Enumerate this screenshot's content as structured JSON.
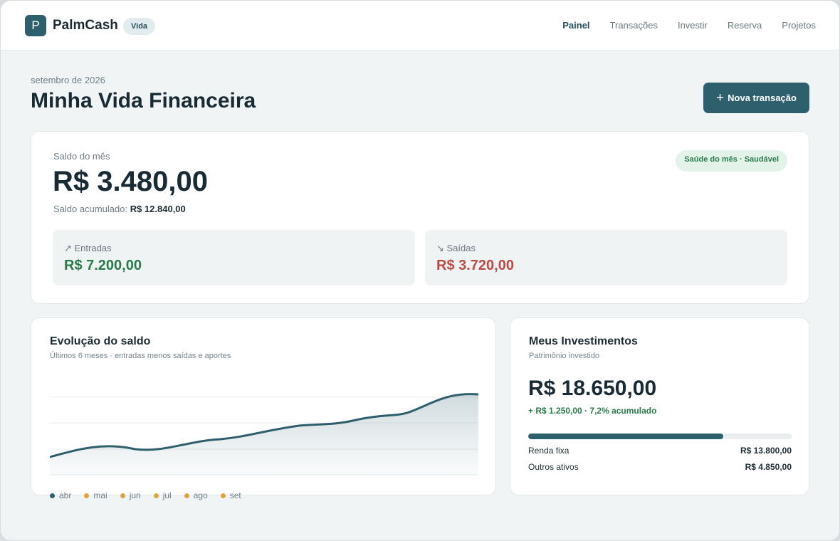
{
  "header": {
    "logo_letter": "P",
    "brand": "PalmCash",
    "badge": "Vida",
    "nav": [
      {
        "label": "Painel",
        "active": true
      },
      {
        "label": "Transações",
        "active": false
      },
      {
        "label": "Investir",
        "active": false
      },
      {
        "label": "Reserva",
        "active": false
      },
      {
        "label": "Projetos",
        "active": false
      }
    ]
  },
  "page": {
    "date": "setembro de 2026",
    "title": "Minha Vida Financeira",
    "new_button": "Nova transação"
  },
  "balance": {
    "label": "Saldo do mês",
    "value": "R$ 3.480,00",
    "accumulated_label": "Saldo acumulado:",
    "accumulated_value": "R$ 12.840,00",
    "health": "Saúde do mês · Saudável",
    "income_label": "↗ Entradas",
    "income_value": "R$ 7.200,00",
    "expense_label": "↘ Saídas",
    "expense_value": "R$ 3.720,00"
  },
  "evolution": {
    "title": "Evolução do saldo",
    "subtitle": "Últimos 6 meses · entradas menos saídas e aportes",
    "months": [
      "abr",
      "mai",
      "jun",
      "jul",
      "ago",
      "set"
    ]
  },
  "investments": {
    "title": "Meus Investimentos",
    "subtitle": "Patrimônio investido",
    "total": "R$ 18.650,00",
    "gain": "+ R$ 1.250,00 · 7,2% acumulado",
    "fixed_share": 0.74,
    "rows": [
      {
        "label": "Renda fixa",
        "value": "R$ 13.800,00"
      },
      {
        "label": "Outros ativos",
        "value": "R$ 4.850,00"
      }
    ]
  },
  "colors": {
    "accent": "#2e5f6d",
    "positive": "#2a7a4c",
    "negative": "#bb4b45",
    "legend_dot": "#e0a43e"
  }
}
